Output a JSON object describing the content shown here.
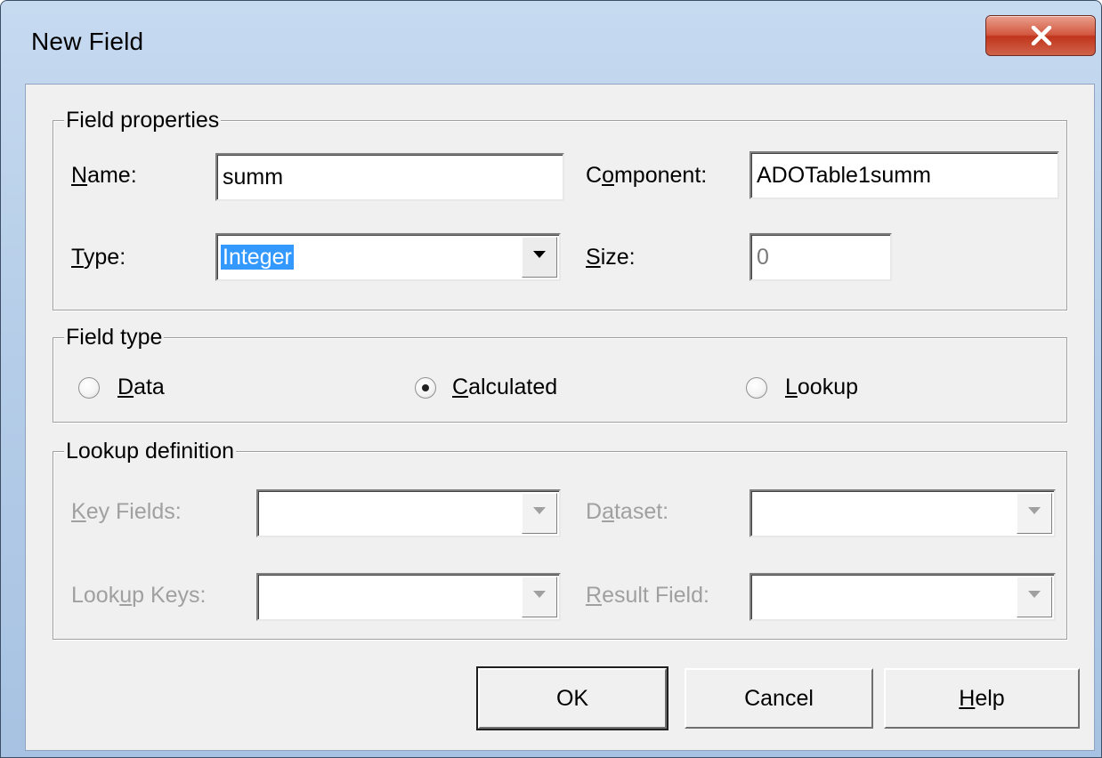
{
  "window": {
    "title": "New Field"
  },
  "field_properties": {
    "legend": "Field properties",
    "name_label": "Name:",
    "name_value": "summ",
    "component_label": "Component:",
    "component_value": "ADOTable1summ",
    "type_label": "Type:",
    "type_value": "Integer",
    "size_label": "Size:",
    "size_value": "0"
  },
  "field_type": {
    "legend": "Field type",
    "options": [
      {
        "label": "Data",
        "selected": false
      },
      {
        "label": "Calculated",
        "selected": true
      },
      {
        "label": "Lookup",
        "selected": false
      }
    ]
  },
  "lookup_definition": {
    "legend": "Lookup definition",
    "key_fields_label": "Key Fields:",
    "key_fields_value": "",
    "dataset_label": "Dataset:",
    "dataset_value": "",
    "lookup_keys_label": "Lookup Keys:",
    "lookup_keys_value": "",
    "result_field_label": "Result Field:",
    "result_field_value": "",
    "enabled": false
  },
  "buttons": {
    "ok": "OK",
    "cancel": "Cancel",
    "help": "Help"
  },
  "icons": {
    "close": "close-icon",
    "dropdown": "chevron-down-icon"
  },
  "colors": {
    "selection": "#3399ff",
    "close_button": "#c0351c",
    "disabled_text": "#a0a0a0"
  }
}
